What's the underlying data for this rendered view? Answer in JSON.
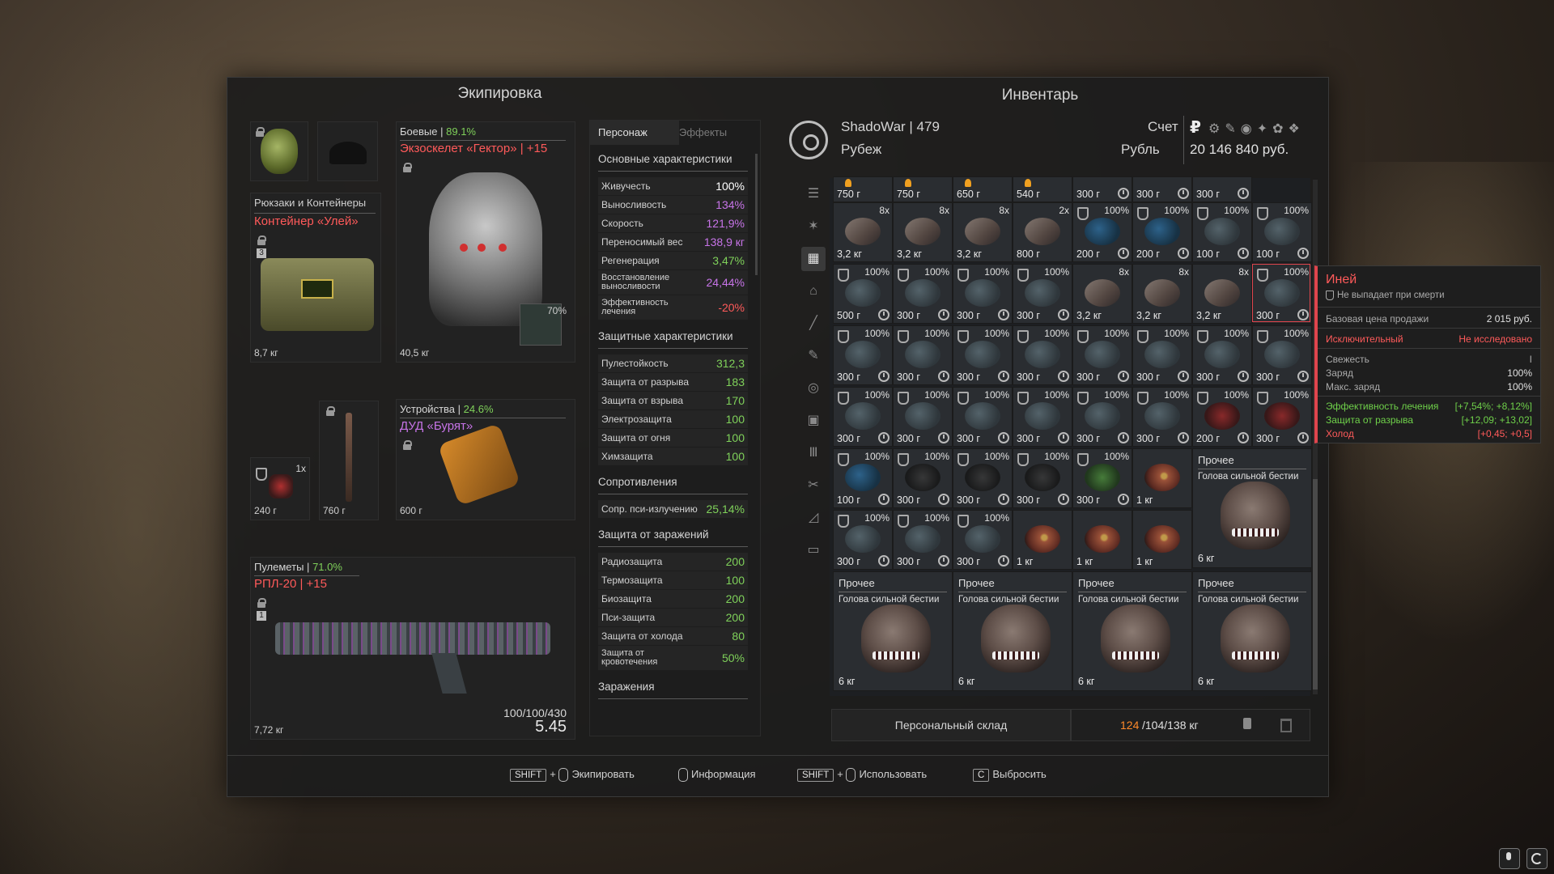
{
  "equipment": {
    "title": "Экипировка",
    "containers": {
      "label": "Рюкзаки и Контейнеры",
      "item": "Контейнер «Улей»",
      "weight": "8,7 кг",
      "badge": "3"
    },
    "armor": {
      "category": "Боевые",
      "sep": "|",
      "percent": "89.1%",
      "item": "Экзоскелет «Гектор» | +15",
      "weight": "40,5 кг",
      "durability": "70%"
    },
    "small1": {
      "count": "1x",
      "weight": "240 г"
    },
    "small2": {
      "weight": "760 г"
    },
    "device": {
      "category": "Устройства",
      "sep": "|",
      "percent": "24.6%",
      "item": "ДУД «Бурят»",
      "weight": "600 г"
    },
    "weapon": {
      "category": "Пулеметы",
      "sep": "|",
      "percent": "71.0%",
      "item": "РПЛ-20 | +15",
      "weight": "7,72 кг",
      "ammo": "100/100/430",
      "value": "5.45",
      "badge": "1"
    }
  },
  "stats": {
    "tabs": [
      {
        "label": "Персонаж"
      },
      {
        "label": "Эффекты"
      }
    ],
    "groups": [
      {
        "title": "Основные характеристики",
        "rows": [
          {
            "k": "Живучесть",
            "v": "100%",
            "c": "#ffffff"
          },
          {
            "k": "Выносливость",
            "v": "134%",
            "c": "#c774e8"
          },
          {
            "k": "Скорость",
            "v": "121,9%",
            "c": "#c774e8"
          },
          {
            "k": "Переносимый вес",
            "v": "138,9 кг",
            "c": "#c774e8"
          },
          {
            "k": "Регенерация",
            "v": "3,47%",
            "c": "#7fd15a"
          },
          {
            "k": "Восстановление выносливости",
            "v": "24,44%",
            "c": "#c774e8"
          },
          {
            "k": "Эффективность лечения",
            "v": "-20%",
            "c": "#ff5a5a"
          }
        ]
      },
      {
        "title": "Защитные характеристики",
        "rows": [
          {
            "k": "Пулестойкость",
            "v": "312,3",
            "c": "#7fd15a"
          },
          {
            "k": "Защита от разрыва",
            "v": "183",
            "c": "#7fd15a"
          },
          {
            "k": "Защита от взрыва",
            "v": "170",
            "c": "#7fd15a"
          },
          {
            "k": "Электрозащита",
            "v": "100",
            "c": "#7fd15a"
          },
          {
            "k": "Защита от огня",
            "v": "100",
            "c": "#7fd15a"
          },
          {
            "k": "Химзащита",
            "v": "100",
            "c": "#7fd15a"
          }
        ]
      },
      {
        "title": "Сопротивления",
        "rows": [
          {
            "k": "Сопр. пси-излучению",
            "v": "25,14%",
            "c": "#7fd15a"
          }
        ]
      },
      {
        "title": "Защита от заражений",
        "rows": [
          {
            "k": "Радиозащита",
            "v": "200",
            "c": "#7fd15a"
          },
          {
            "k": "Термозащита",
            "v": "100",
            "c": "#7fd15a"
          },
          {
            "k": "Биозащита",
            "v": "200",
            "c": "#7fd15a"
          },
          {
            "k": "Пси-защита",
            "v": "200",
            "c": "#7fd15a"
          },
          {
            "k": "Защита от холода",
            "v": "80",
            "c": "#7fd15a"
          },
          {
            "k": "Защита от кровотечения",
            "v": "50%",
            "c": "#7fd15a"
          }
        ]
      },
      {
        "title": "Заражения",
        "rows": []
      }
    ]
  },
  "inventory": {
    "title": "Инвентарь",
    "player": "ShadoWar | 479",
    "faction": "Рубеж",
    "account_label": "Счет",
    "currency_symbol": "₽",
    "currency_label": "Рубль",
    "balance": "20 146 840 руб.",
    "storage_label": "Персональный склад",
    "weight_current": "124",
    "weight_rest": "/104/138 кг",
    "top_row": [
      "750 г",
      "750 г",
      "650 г",
      "540 г",
      "300 г",
      "300 г",
      "300 г"
    ],
    "rows": [
      [
        {
          "w": "3,2 кг",
          "n": "8x",
          "a": "claw"
        },
        {
          "w": "3,2 кг",
          "n": "8x",
          "a": "claw"
        },
        {
          "w": "3,2 кг",
          "n": "8x",
          "a": "claw"
        },
        {
          "w": "800 г",
          "n": "2x",
          "a": "claw"
        },
        {
          "w": "200 г",
          "p": "100%",
          "a": "blue"
        },
        {
          "w": "200 г",
          "p": "100%",
          "a": "blue"
        },
        {
          "w": "100 г",
          "p": "100%",
          "a": "stone"
        },
        {
          "w": "100 г",
          "p": "100%",
          "a": "stone"
        }
      ],
      [
        {
          "w": "500 г",
          "p": "100%",
          "a": "stone"
        },
        {
          "w": "300 г",
          "p": "100%",
          "a": "stone"
        },
        {
          "w": "300 г",
          "p": "100%",
          "a": "stone"
        },
        {
          "w": "300 г",
          "p": "100%",
          "a": "stone"
        },
        {
          "w": "3,2 кг",
          "n": "8x",
          "a": "claw"
        },
        {
          "w": "3,2 кг",
          "n": "8x",
          "a": "claw"
        },
        {
          "w": "3,2 кг",
          "n": "8x",
          "a": "claw"
        },
        {
          "w": "300 г",
          "p": "100%",
          "a": "stone"
        }
      ],
      [
        {
          "w": "300 г",
          "p": "100%",
          "a": "stone"
        },
        {
          "w": "300 г",
          "p": "100%",
          "a": "stone"
        },
        {
          "w": "300 г",
          "p": "100%",
          "a": "stone"
        },
        {
          "w": "300 г",
          "p": "100%",
          "a": "stone"
        },
        {
          "w": "300 г",
          "p": "100%",
          "a": "stone"
        },
        {
          "w": "300 г",
          "p": "100%",
          "a": "stone"
        },
        {
          "w": "300 г",
          "p": "100%",
          "a": "stone"
        },
        {
          "w": "300 г",
          "p": "100%",
          "a": "stone"
        }
      ],
      [
        {
          "w": "300 г",
          "p": "100%",
          "a": "stone"
        },
        {
          "w": "300 г",
          "p": "100%",
          "a": "stone"
        },
        {
          "w": "300 г",
          "p": "100%",
          "a": "stone"
        },
        {
          "w": "300 г",
          "p": "100%",
          "a": "stone"
        },
        {
          "w": "300 г",
          "p": "100%",
          "a": "stone"
        },
        {
          "w": "300 г",
          "p": "100%",
          "a": "stone"
        },
        {
          "w": "200 г",
          "p": "100%",
          "a": "red"
        },
        {
          "w": "300 г",
          "p": "100%",
          "a": "red"
        }
      ],
      [
        {
          "w": "100 г",
          "p": "100%",
          "a": "blue"
        },
        {
          "w": "300 г",
          "p": "100%",
          "a": "dark"
        },
        {
          "w": "300 г",
          "p": "100%",
          "a": "dark"
        },
        {
          "w": "300 г",
          "p": "100%",
          "a": "dark"
        },
        {
          "w": "300 г",
          "p": "100%",
          "a": "green"
        },
        {
          "w": "1 кг",
          "a": "eye"
        }
      ],
      [
        {
          "w": "300 г",
          "p": "100%",
          "a": "stone"
        },
        {
          "w": "300 г",
          "p": "100%",
          "a": "stone"
        },
        {
          "w": "300 г",
          "p": "100%",
          "a": "stone"
        },
        {
          "w": "1 кг",
          "a": "eye"
        },
        {
          "w": "1 кг",
          "a": "eye"
        },
        {
          "w": "1 кг",
          "a": "eye"
        }
      ]
    ],
    "big_items": [
      {
        "t1": "Прочее",
        "t2": "Голова сильной бестии",
        "w": "6 кг"
      },
      {
        "t1": "Прочее",
        "t2": "Голова сильной бестии",
        "w": "6 кг"
      },
      {
        "t1": "Прочее",
        "t2": "Голова сильной бестии",
        "w": "6 кг"
      },
      {
        "t1": "Прочее",
        "t2": "Голова сильной бестии",
        "w": "6 кг"
      },
      {
        "t1": "Прочее",
        "t2": "Голова сильной бестии",
        "w": "6 кг"
      }
    ]
  },
  "tooltip": {
    "name": "Иней",
    "no_drop": "Не выпадает при смерти",
    "price_label": "Базовая цена продажи",
    "price": "2 015 руб.",
    "rarity": "Исключительный",
    "research": "Не исследовано",
    "fresh_label": "Свежесть",
    "fresh_value": "I",
    "charge_label": "Заряд",
    "charge": "100%",
    "max_charge_label": "Макс. заряд",
    "max_charge": "100%",
    "eff1_label": "Эффективность лечения",
    "eff1": "[+7,54%; +8,12%]",
    "eff2_label": "Защита от разрыва",
    "eff2": "[+12,09; +13,02]",
    "eff3_label": "Холод",
    "eff3": "[+0,45; +0,5]"
  },
  "hints": {
    "shift": "SHIFT",
    "plus": "+",
    "equip": "Экипировать",
    "info": "Информация",
    "use": "Использовать",
    "c_key": "C",
    "drop": "Выбросить"
  },
  "colors": {
    "accent_red": "#e0454d",
    "green": "#7fd15a",
    "purple": "#c774e8"
  }
}
